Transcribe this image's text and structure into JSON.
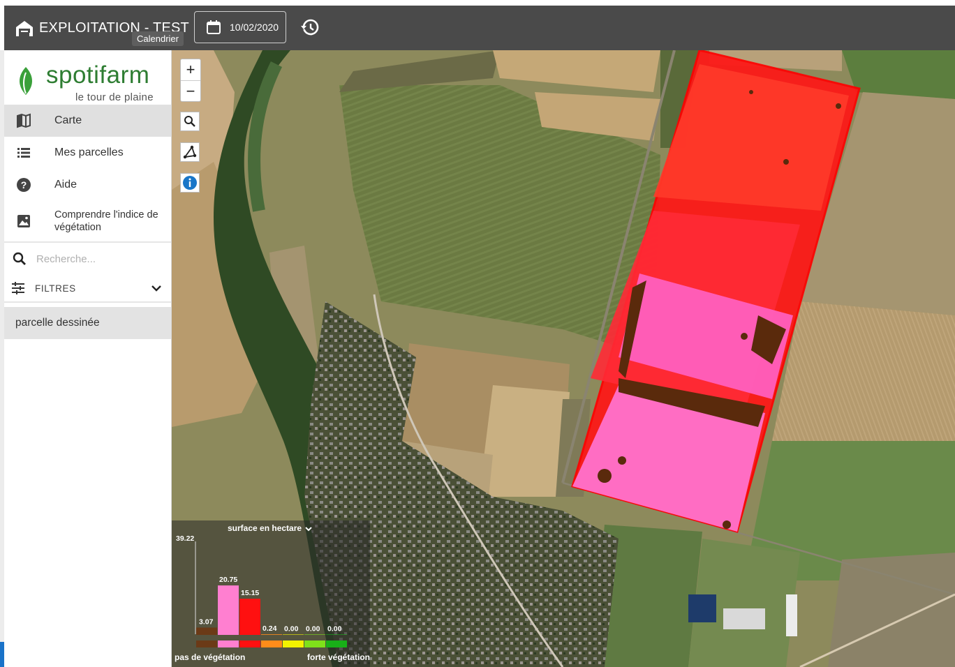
{
  "header": {
    "farm_name": "EXPLOITATION - TEST",
    "tooltip": "Calendrier",
    "date": "10/02/2020",
    "icons": [
      "farm-icon",
      "calendar-icon",
      "history-icon"
    ]
  },
  "sidebar": {
    "logo": {
      "brand": "spotifarm",
      "tagline": "le tour de plaine"
    },
    "menu": [
      {
        "label": "Carte",
        "icon": "map-icon",
        "active": true
      },
      {
        "label": "Mes parcelles",
        "icon": "list-icon",
        "active": false
      },
      {
        "label": "Aide",
        "icon": "help-icon",
        "active": false
      },
      {
        "label": "Comprendre l'indice de végétation",
        "icon": "image-icon",
        "active": false
      }
    ],
    "search": {
      "placeholder": "Recherche..."
    },
    "filters": {
      "label": "FILTRES"
    },
    "parcels": [
      {
        "label": "parcelle dessinée"
      }
    ]
  },
  "map": {
    "controls": {
      "zoom_in": "+",
      "zoom_out": "−"
    },
    "control_icons": [
      "search-icon",
      "draw-polygon-icon",
      "info-icon"
    ]
  },
  "legend": {
    "title": "surface en hectare",
    "y_max": "39.22",
    "left_label": "pas de végétation",
    "right_label": "forte végétation"
  },
  "chart_data": {
    "type": "bar",
    "title": "surface en hectare",
    "values": [
      3.07,
      20.75,
      15.15,
      0.24,
      0.0,
      0.0,
      0.0
    ],
    "value_labels": [
      "3.07",
      "20.75",
      "15.15",
      "0.24",
      "0.00",
      "0.00",
      "0.00"
    ],
    "colors": [
      "#6b3a17",
      "#ff7fd0",
      "#ff1010",
      "#ff8c1a",
      "#f2f200",
      "#7fe01a",
      "#18b018"
    ],
    "ylim": [
      0,
      39.22
    ]
  }
}
